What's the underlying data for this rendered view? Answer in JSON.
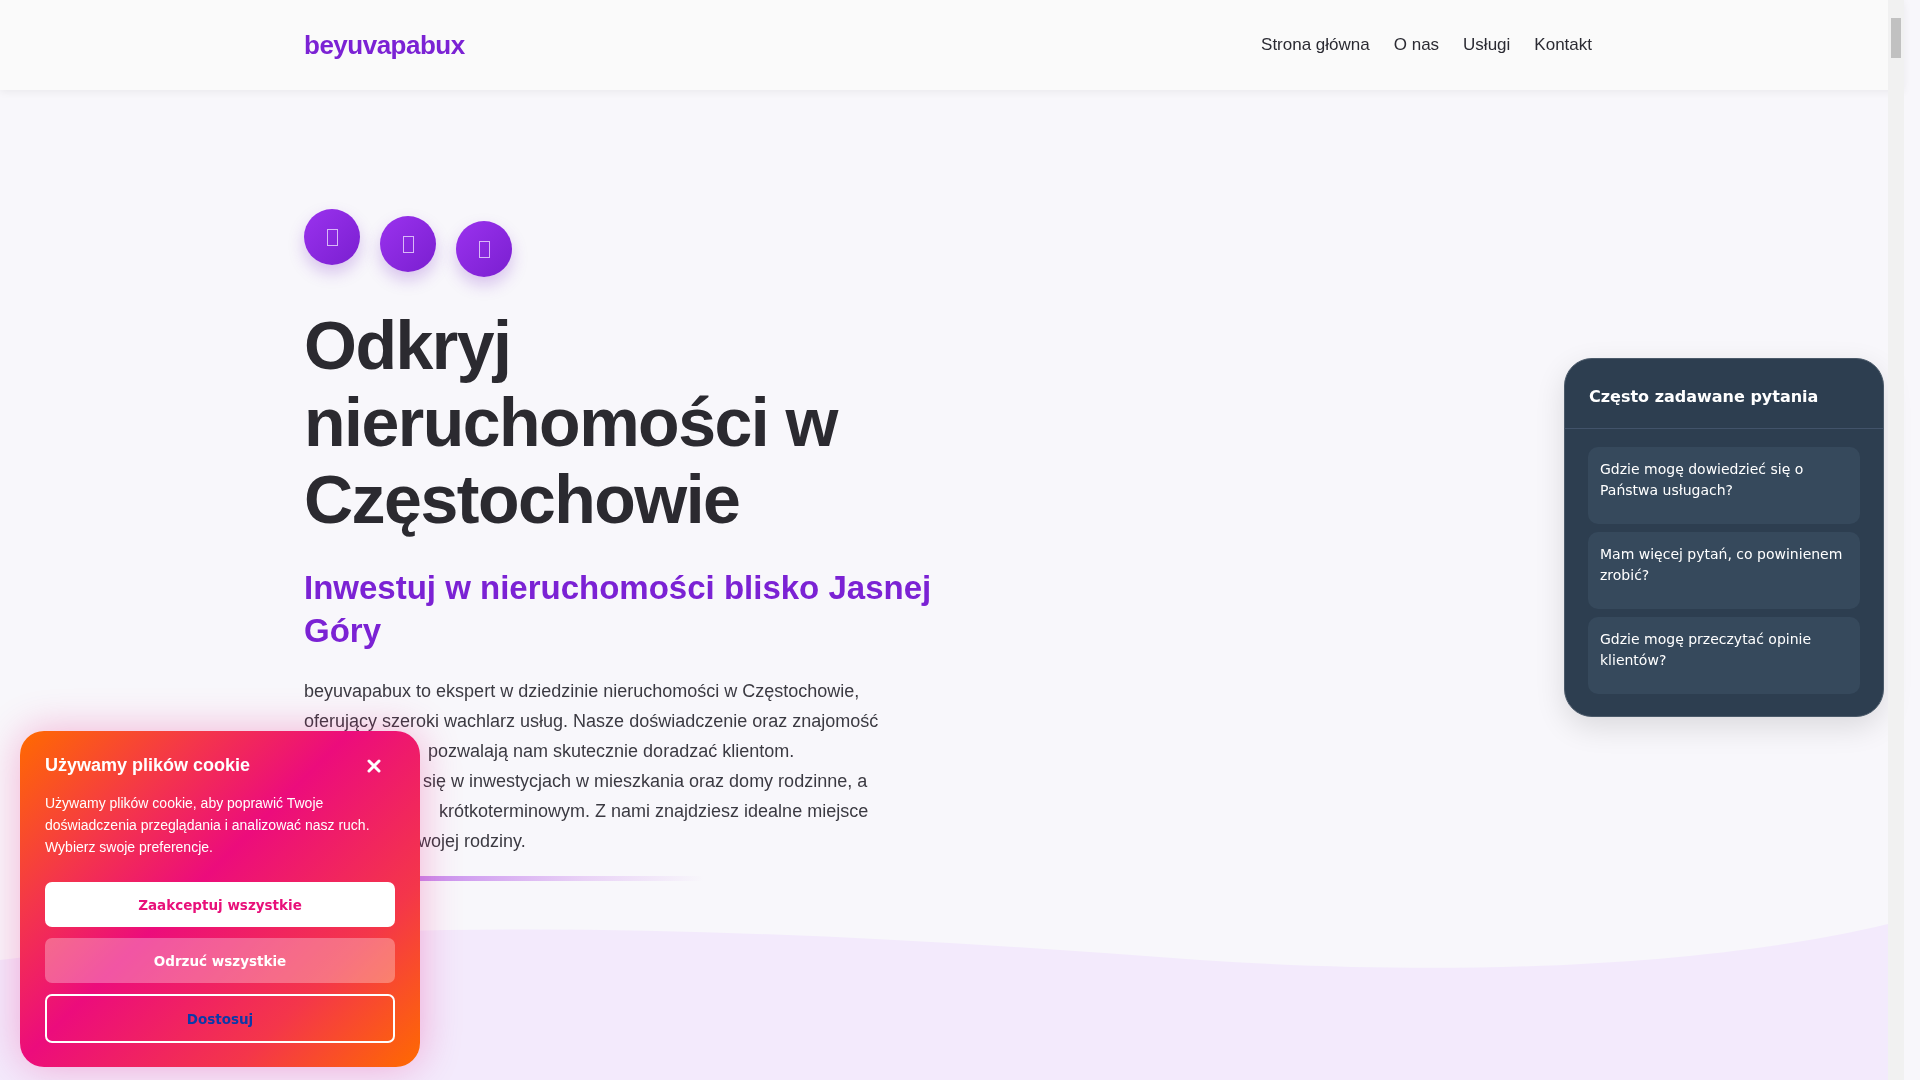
{
  "header": {
    "logo": "beyuvapabux",
    "nav": [
      {
        "label": "Strona główna"
      },
      {
        "label": "O nas"
      },
      {
        "label": "Usługi"
      },
      {
        "label": "Kontakt"
      }
    ]
  },
  "hero": {
    "title": "Odkryj nieruchomości w Częstochowie",
    "subtitle": "Inwestuj w nieruchomości blisko Jasnej Góry",
    "paragraph_lines": [
      "beyuvapabux to ekspert w dziedzinie nieruchomości w Częstochowie,",
      "oferujący szeroki wachlarz usług. Nasze doświadczenie oraz znajomość",
      "pozwalają nam skutecznie doradzać klientom.",
      "się w inwestycjach w mieszkania oraz domy rodzinne, a",
      "krótkoterminowym. Z nami znajdziesz idealne miejsce",
      "wojej rodziny."
    ]
  },
  "faq": {
    "title": "Często zadawane pytania",
    "questions": [
      "Gdzie mogę dowiedzieć się o Państwa usługach?",
      "Mam więcej pytań, co powinienem zrobić?",
      "Gdzie mogę przeczytać opinie klientów?"
    ]
  },
  "cookie_banner": {
    "title": "Używamy plików cookie",
    "text": "Używamy plików cookie, aby poprawić Twoje doświadczenia przeglądania i analizować nasz ruch. Wybierz swoje preferencje.",
    "buttons": [
      {
        "label": "Zaakceptuj wszystkie",
        "kind": "accept"
      },
      {
        "label": "Odrzuć wszystkie",
        "kind": "reject"
      },
      {
        "label": "Dostosuj",
        "kind": "customize"
      }
    ]
  }
}
